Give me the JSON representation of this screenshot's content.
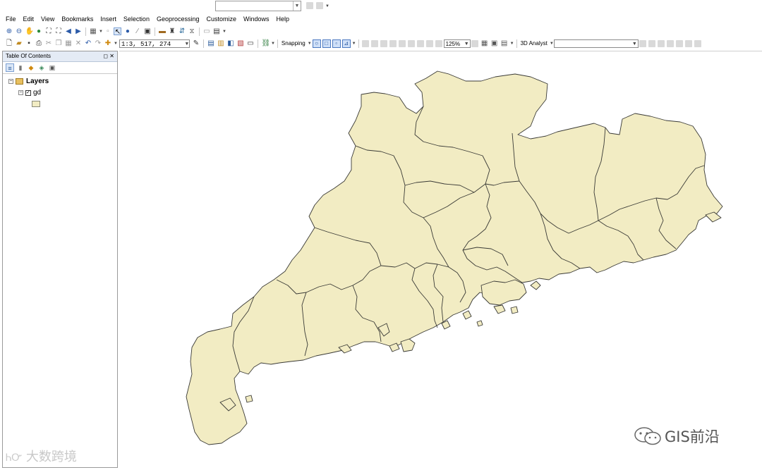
{
  "menu": [
    "File",
    "Edit",
    "View",
    "Bookmarks",
    "Insert",
    "Selection",
    "Geoprocessing",
    "Customize",
    "Windows",
    "Help"
  ],
  "toolbar": {
    "scale_value": "1:3, 517, 274",
    "snapping_label": "Snapping",
    "zoom_value": "125%",
    "analyst_label": "3D Analyst"
  },
  "toc": {
    "title": "Table Of Contents",
    "root_label": "Layers",
    "layer_label": "gd"
  },
  "map": {
    "fill_color": "#f2ecc3",
    "stroke_color": "#3a3a36"
  },
  "watermarks": {
    "bottom_left": "大数跨境",
    "bottom_right": "GIS前沿"
  }
}
